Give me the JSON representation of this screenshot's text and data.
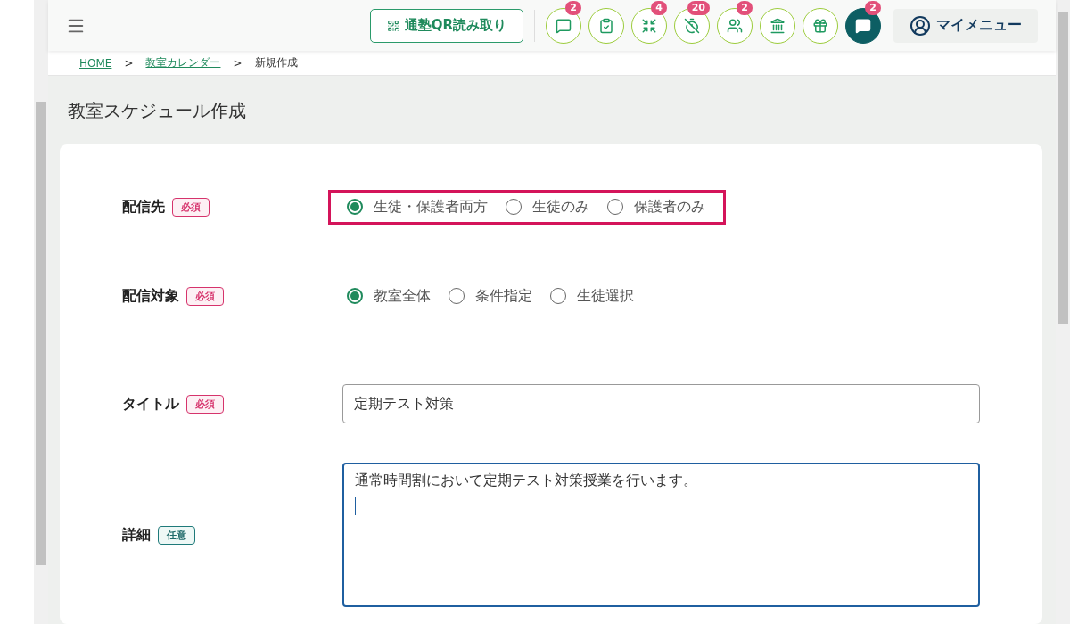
{
  "header": {
    "qr_button": "通塾QR読み取り",
    "icon_buttons": [
      {
        "kind": "outline",
        "badge": "2"
      },
      {
        "kind": "outline"
      },
      {
        "kind": "outline",
        "badge": "4"
      },
      {
        "kind": "outline",
        "badge": "20"
      },
      {
        "kind": "outline",
        "badge": "2"
      },
      {
        "kind": "outline"
      },
      {
        "kind": "outline"
      },
      {
        "kind": "filled",
        "badge": "2"
      }
    ],
    "my_menu": "マイメニュー"
  },
  "breadcrumb": [
    {
      "label": "HOME",
      "link": true
    },
    {
      "label": ">",
      "link": false
    },
    {
      "label": "教室カレンダー",
      "link": true
    },
    {
      "label": ">",
      "link": false
    },
    {
      "label": "新規作成",
      "link": false
    }
  ],
  "page_title": "教室スケジュール作成",
  "fields": [
    {
      "kind": "radio",
      "label": "配信先",
      "tag": {
        "kind": "required",
        "text": "必須"
      },
      "highlighted": true,
      "options": [
        {
          "label": "生徒・保護者両方",
          "selected": true
        },
        {
          "label": "生徒のみ",
          "selected": false
        },
        {
          "label": "保護者のみ",
          "selected": false
        }
      ]
    },
    {
      "kind": "radio",
      "label": "配信対象",
      "tag": {
        "kind": "required",
        "text": "必須"
      },
      "highlighted": false,
      "divider_after": true,
      "options": [
        {
          "label": "教室全体",
          "selected": true
        },
        {
          "label": "条件指定",
          "selected": false
        },
        {
          "label": "生徒選択",
          "selected": false
        }
      ]
    },
    {
      "kind": "text",
      "label": "タイトル",
      "tag": {
        "kind": "required",
        "text": "必須"
      },
      "value": "定期テスト対策"
    },
    {
      "kind": "textarea",
      "label": "詳細",
      "tag": {
        "kind": "optional",
        "text": "任意"
      },
      "value": "通常時間割において定期テスト対策授業を行います。",
      "focused": true
    }
  ]
}
